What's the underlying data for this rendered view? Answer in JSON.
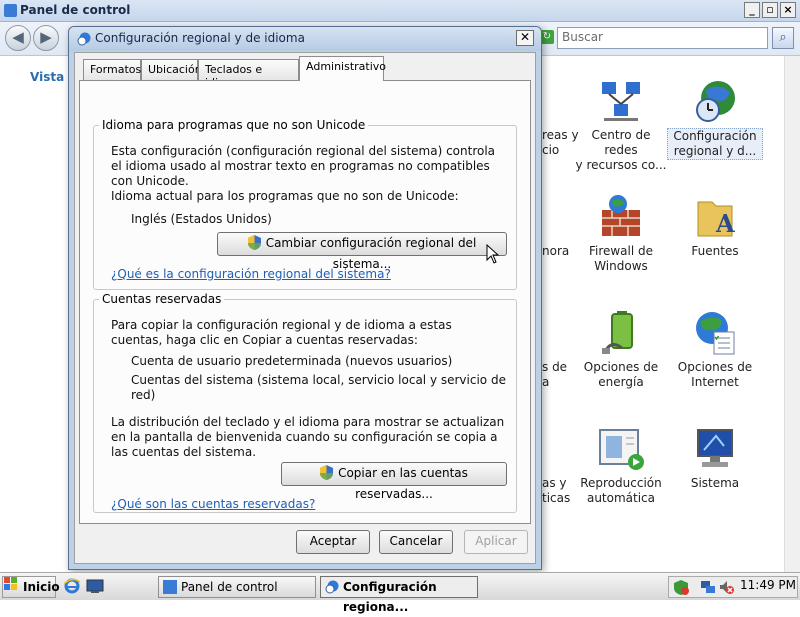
{
  "control_panel": {
    "title": "Panel de control",
    "search_placeholder": "Buscar",
    "vista_link": "Vista c",
    "items": [
      {
        "label_line1": "Centro de redes",
        "label_line2": "y recursos co..."
      },
      {
        "label_line1": "Configuración",
        "label_line2": "regional y d..."
      },
      {
        "label_line1": "Firewall de",
        "label_line2": "Windows"
      },
      {
        "label_line1": "Fuentes",
        "label_line2": ""
      },
      {
        "label_line1": "Opciones de",
        "label_line2": "energía"
      },
      {
        "label_line1": "Opciones de",
        "label_line2": "Internet"
      },
      {
        "label_line1": "Reproducción",
        "label_line2": "automática"
      },
      {
        "label_line1": "Sistema",
        "label_line2": ""
      }
    ],
    "partial_labels": [
      {
        "line1": "reas y",
        "line2": "cio"
      },
      {
        "line1": "nora",
        "line2": ""
      },
      {
        "line1": "s de",
        "line2": "a"
      },
      {
        "line1": "as y",
        "line2": "ticas"
      }
    ]
  },
  "dialog": {
    "title": "Configuración regional y de idioma",
    "tabs": [
      "Formatos",
      "Ubicación",
      "Teclados e idiomas",
      "Administrativo"
    ],
    "active_tab": "Administrativo",
    "unicode_group": {
      "legend": "Idioma para programas que no son Unicode",
      "description": "Esta configuración (configuración regional del sistema) controla el idioma usado al mostrar texto en programas no compatibles con Unicode.",
      "current_label": "Idioma actual para los programas que no son de Unicode:",
      "current_value": "Inglés (Estados Unidos)",
      "change_button": "Cambiar configuración regional del sistema...",
      "help_link": "¿Qué es la configuración regional del sistema?"
    },
    "reserved_group": {
      "legend": "Cuentas reservadas",
      "description": "Para copiar la configuración regional y de idioma a estas cuentas, haga clic en Copiar a cuentas reservadas:",
      "account_1": "Cuenta de usuario predeterminada (nuevos usuarios)",
      "account_2": "Cuentas del sistema (sistema local, servicio local y servicio de red)",
      "note": "La distribución del teclado y el idioma para mostrar se actualizan en la pantalla de bienvenida cuando su configuración se copia a las cuentas del sistema.",
      "copy_button": "Copiar en las cuentas reservadas...",
      "help_link": "¿Qué son las cuentas reservadas?"
    },
    "buttons": {
      "ok": "Aceptar",
      "cancel": "Cancelar",
      "apply": "Aplicar"
    }
  },
  "taskbar": {
    "start_label": "Inicio",
    "tasks": [
      "Panel de control",
      "Configuración regiona..."
    ],
    "clock": "11:49 PM"
  },
  "colors": {
    "accent": "#1f5fb5",
    "title_bar": "#bcd0e6"
  }
}
